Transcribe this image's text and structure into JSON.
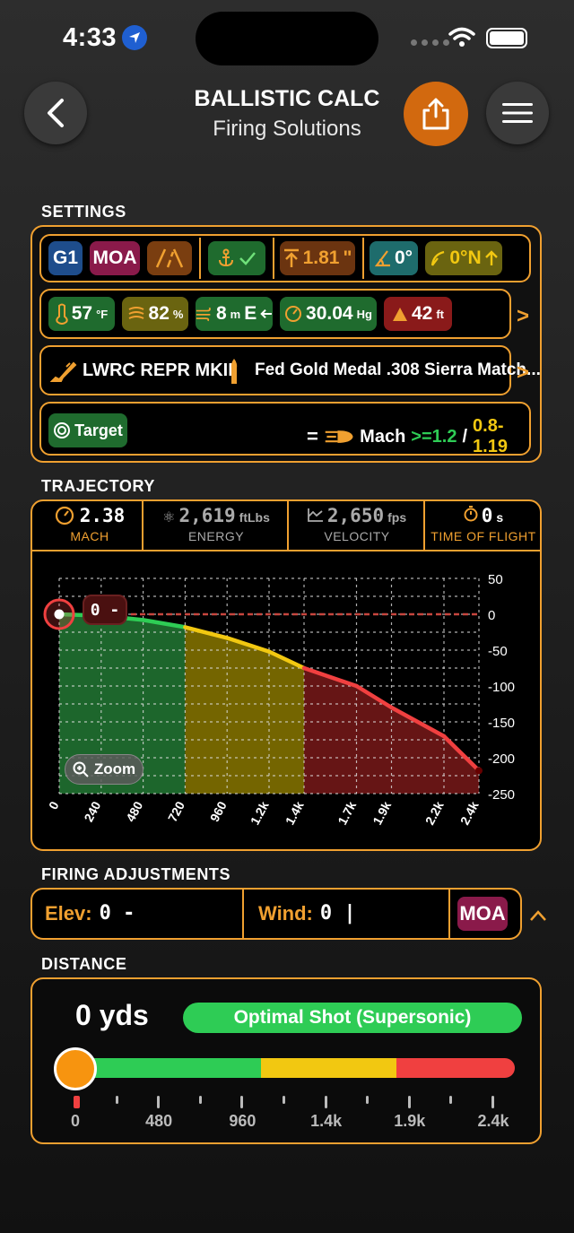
{
  "status": {
    "time": "4:33"
  },
  "header": {
    "title": "BALLISTIC CALC",
    "subtitle": "Firing Solutions"
  },
  "sections": {
    "settings": "SETTINGS",
    "trajectory": "TRAJECTORY",
    "firing": "FIRING ADJUSTMENTS",
    "distance": "DISTANCE"
  },
  "settings": {
    "drag_model": "G1",
    "unit": "MOA",
    "zero_value": "1.81",
    "zero_unit": "\"",
    "cant": "0°",
    "direction": "0°N",
    "temperature": "57",
    "temperature_unit": "°F",
    "humidity": "82",
    "humidity_unit": "%",
    "wind": "8",
    "wind_unit": "m",
    "wind_dir": "E",
    "pressure": "30.04",
    "pressure_unit": "Hg",
    "altitude": "42",
    "altitude_unit": "ft",
    "rifle": "LWRC REPR MKII",
    "ammo": "Fed Gold Medal .308 Sierra Match...",
    "target_label": "Target",
    "mach_label": "Mach",
    "mach_super": ">=1.2",
    "mach_sep": "/",
    "mach_trans": "0.8-1.19"
  },
  "trajectory": {
    "mach": {
      "value": "2.38",
      "label": "MACH"
    },
    "energy": {
      "value": "2,619",
      "unit": "ftLbs",
      "label": "ENERGY"
    },
    "velocity": {
      "value": "2,650",
      "unit": "fps",
      "label": "VELOCITY"
    },
    "tof": {
      "value": "0",
      "unit": "s",
      "label": "TIME OF FLIGHT"
    },
    "zoom_label": "Zoom",
    "marker_label": "0 -"
  },
  "chart_data": {
    "type": "line",
    "x": [
      0,
      240,
      480,
      720,
      960,
      1200,
      1400,
      1700,
      1900,
      2200,
      2400
    ],
    "x_tick_labels": [
      "0",
      "240",
      "480",
      "720",
      "960",
      "1.2k",
      "1.4k",
      "1.7k",
      "1.9k",
      "2.2k",
      "2.4k"
    ],
    "y_tick_labels": [
      "50",
      "0",
      "-50",
      "-100",
      "-150",
      "-200",
      "-250"
    ],
    "ylim": [
      -250,
      50
    ],
    "series": [
      {
        "values": [
          0,
          -2,
          -8,
          -18,
          -33,
          -52,
          -75,
          -100,
          -130,
          -170,
          -218
        ]
      }
    ],
    "zones": [
      {
        "from": 0,
        "to": 720,
        "color": "#1f6b2e"
      },
      {
        "from": 720,
        "to": 1400,
        "color": "#7a6a00"
      },
      {
        "from": 1400,
        "to": 2400,
        "color": "#6b1616"
      }
    ],
    "grid": true
  },
  "firing": {
    "elev_label": "Elev:",
    "elev_value": "0 -",
    "wind_label": "Wind:",
    "wind_value": "0 |",
    "unit": "MOA"
  },
  "distance": {
    "value": "0 yds",
    "status": "Optimal Shot (Supersonic)",
    "tick_labels": [
      "0",
      "480",
      "960",
      "1.4k",
      "1.9k",
      "2.4k"
    ]
  },
  "colors": {
    "accent": "#f0a030",
    "green": "#2ecc55",
    "yellow": "#f2c811",
    "red": "#f04040"
  }
}
